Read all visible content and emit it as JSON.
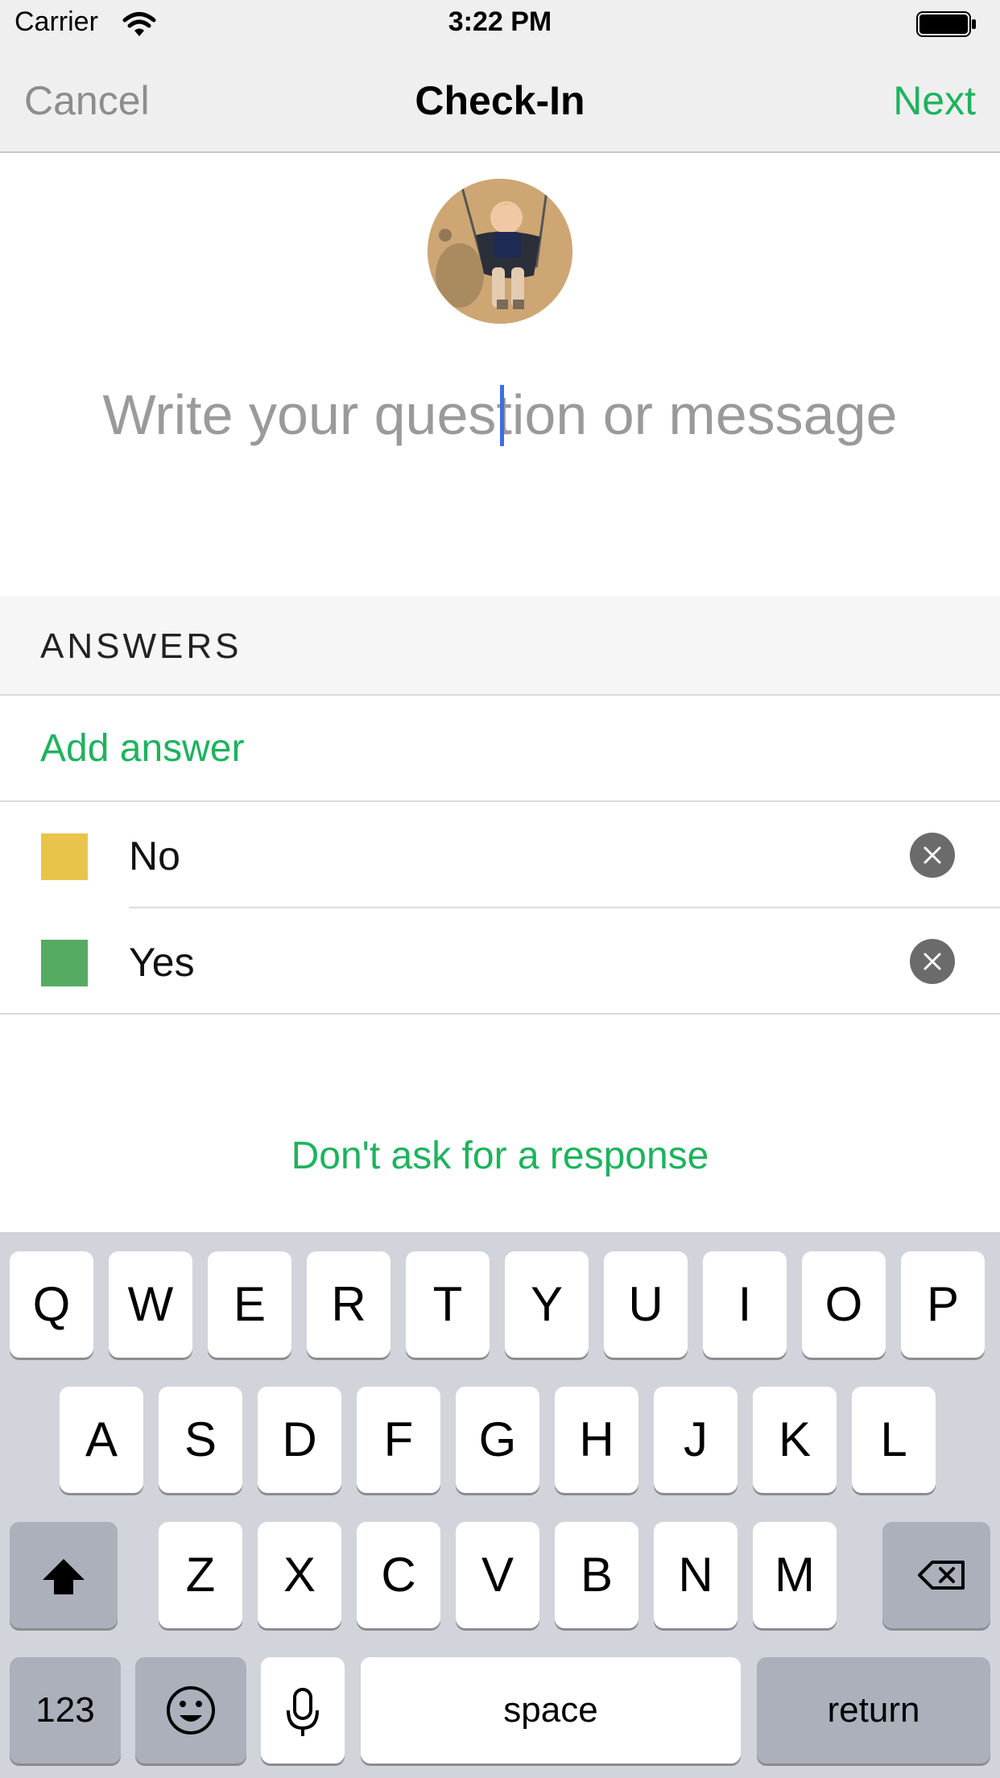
{
  "status_bar": {
    "carrier": "Carrier",
    "time": "3:22 PM"
  },
  "nav": {
    "cancel_label": "Cancel",
    "title": "Check-In",
    "next_label": "Next"
  },
  "message": {
    "placeholder": "Write your question or message"
  },
  "answers": {
    "header": "ANSWERS",
    "add_label": "Add answer",
    "items": [
      {
        "label": "No",
        "color": "#e8c44a"
      },
      {
        "label": "Yes",
        "color": "#55ab62"
      }
    ]
  },
  "no_response_label": "Don't ask for a response",
  "keyboard": {
    "row1": [
      "Q",
      "W",
      "E",
      "R",
      "T",
      "Y",
      "U",
      "I",
      "O",
      "P"
    ],
    "row2": [
      "A",
      "S",
      "D",
      "F",
      "G",
      "H",
      "J",
      "K",
      "L"
    ],
    "row3": [
      "Z",
      "X",
      "C",
      "V",
      "B",
      "N",
      "M"
    ],
    "numbers_label": "123",
    "space_label": "space",
    "return_label": "return"
  },
  "colors": {
    "accent": "#1db35e",
    "cursor": "#3f6ce8"
  }
}
